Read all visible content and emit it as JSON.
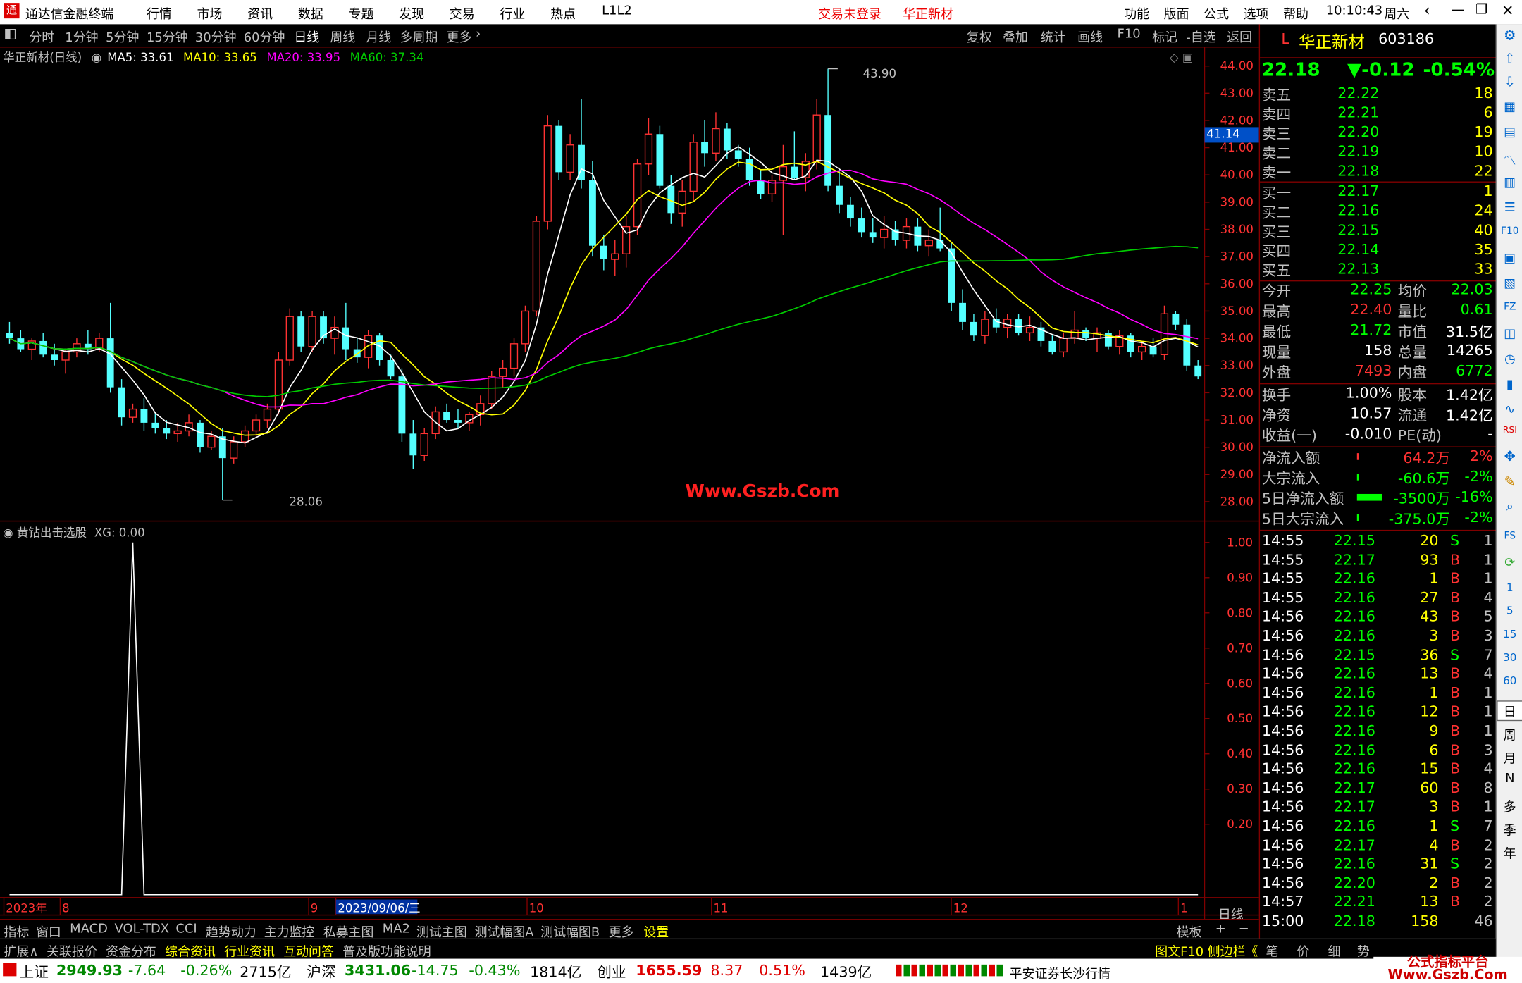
{
  "app": {
    "title": "通达信金融终端",
    "menu": [
      "行情",
      "市场",
      "资讯",
      "数据",
      "专题",
      "发现",
      "交易",
      "行业",
      "热点",
      "L1L2"
    ],
    "login_status": "交易未登录",
    "stock_tab": "华正新材",
    "right_menu": [
      "功能",
      "版面",
      "公式",
      "选项",
      "帮助"
    ],
    "time": "10:10:43",
    "weekday": "周六"
  },
  "periods": [
    "分时",
    "1分钟",
    "5分钟",
    "15分钟",
    "30分钟",
    "60分钟",
    "日线",
    "周线",
    "月线",
    "多周期",
    "更多"
  ],
  "active_period": "日线",
  "chart_tools": [
    "复权",
    "叠加",
    "统计",
    "画线",
    "F10",
    "标记",
    "-自选",
    "返回"
  ],
  "main_chart": {
    "title": "华正新材(日线)",
    "ma5": "MA5: 33.61",
    "ma10": "MA10: 33.65",
    "ma20": "MA20: 33.95",
    "ma60": "MA60: 37.34",
    "high_label": "43.90",
    "low_label": "28.06",
    "cursor_price": "41.14",
    "watermark": "Www.Gszb.Com",
    "y_ticks": [
      "44.00",
      "43.00",
      "42.00",
      "41.00",
      "40.00",
      "39.00",
      "38.00",
      "37.00",
      "36.00",
      "35.00",
      "34.00",
      "33.00",
      "32.00",
      "31.00",
      "30.00",
      "29.00",
      "28.00"
    ]
  },
  "indicator": {
    "title": "黄钻出击选股",
    "value": "XG: 0.00",
    "y_ticks": [
      "1.00",
      "0.90",
      "0.80",
      "0.70",
      "0.60",
      "0.50",
      "0.40",
      "0.30",
      "0.20"
    ]
  },
  "x_axis": {
    "labels": [
      "2023年",
      "8",
      "9",
      "2023/09/06/三",
      "10",
      "11",
      "12",
      "1"
    ],
    "period": "日线"
  },
  "chart_data": {
    "type": "candlestick",
    "ohlc_approx": [
      [
        34.2,
        34.6,
        33.8,
        34.0
      ],
      [
        34.0,
        34.3,
        33.5,
        33.6
      ],
      [
        33.6,
        34.0,
        33.2,
        33.9
      ],
      [
        33.9,
        34.2,
        33.3,
        33.4
      ],
      [
        33.4,
        33.8,
        33.0,
        33.2
      ],
      [
        33.2,
        33.6,
        32.7,
        33.5
      ],
      [
        33.5,
        34.0,
        33.3,
        33.8
      ],
      [
        33.8,
        34.3,
        33.4,
        33.6
      ],
      [
        33.6,
        34.2,
        33.5,
        34.0
      ],
      [
        34.0,
        35.3,
        32.0,
        32.2
      ],
      [
        32.2,
        32.5,
        30.8,
        31.1
      ],
      [
        31.1,
        31.6,
        30.9,
        31.4
      ],
      [
        31.4,
        31.8,
        30.6,
        30.9
      ],
      [
        30.9,
        31.3,
        30.5,
        30.7
      ],
      [
        30.7,
        31.0,
        30.3,
        30.5
      ],
      [
        30.5,
        30.9,
        30.2,
        30.6
      ],
      [
        30.6,
        31.2,
        30.4,
        30.9
      ],
      [
        30.9,
        31.0,
        29.8,
        30.0
      ],
      [
        30.0,
        30.6,
        29.9,
        30.4
      ],
      [
        30.4,
        30.7,
        28.06,
        29.6
      ],
      [
        29.6,
        30.4,
        29.4,
        30.2
      ],
      [
        30.2,
        30.8,
        30.0,
        30.6
      ],
      [
        30.6,
        31.2,
        30.4,
        31.0
      ],
      [
        31.0,
        31.6,
        30.7,
        31.4
      ],
      [
        31.4,
        33.5,
        31.2,
        33.2
      ],
      [
        33.2,
        35.1,
        33.0,
        34.8
      ],
      [
        34.8,
        35.0,
        33.5,
        33.7
      ],
      [
        33.7,
        35.0,
        33.5,
        34.8
      ],
      [
        34.8,
        35.0,
        33.8,
        34.0
      ],
      [
        34.0,
        34.8,
        33.4,
        34.4
      ],
      [
        34.4,
        35.3,
        33.2,
        33.6
      ],
      [
        33.6,
        34.0,
        33.1,
        33.3
      ],
      [
        33.3,
        34.3,
        32.9,
        34.1
      ],
      [
        34.1,
        34.2,
        33.0,
        33.2
      ],
      [
        33.2,
        33.4,
        32.5,
        32.6
      ],
      [
        32.6,
        32.9,
        30.2,
        30.5
      ],
      [
        30.5,
        31.0,
        29.2,
        29.7
      ],
      [
        29.7,
        30.7,
        29.5,
        30.5
      ],
      [
        30.5,
        31.5,
        30.3,
        31.3
      ],
      [
        31.3,
        31.6,
        30.9,
        31.0
      ],
      [
        31.0,
        31.4,
        30.7,
        30.9
      ],
      [
        30.9,
        31.3,
        30.6,
        31.2
      ],
      [
        31.2,
        31.9,
        30.8,
        31.6
      ],
      [
        31.6,
        32.8,
        31.4,
        32.6
      ],
      [
        32.6,
        33.2,
        32.2,
        32.9
      ],
      [
        32.9,
        34.0,
        32.6,
        33.8
      ],
      [
        33.8,
        35.2,
        33.5,
        35.0
      ],
      [
        35.0,
        38.5,
        34.8,
        38.3
      ],
      [
        38.3,
        42.2,
        38.0,
        41.8
      ],
      [
        41.8,
        42.0,
        39.8,
        40.1
      ],
      [
        40.1,
        41.5,
        39.8,
        41.1
      ],
      [
        41.1,
        42.8,
        39.5,
        39.8
      ],
      [
        39.8,
        40.5,
        37.0,
        37.4
      ],
      [
        37.4,
        37.8,
        36.5,
        36.9
      ],
      [
        36.9,
        37.6,
        36.3,
        37.1
      ],
      [
        37.1,
        38.5,
        36.6,
        38.1
      ],
      [
        38.1,
        40.6,
        37.8,
        40.4
      ],
      [
        40.4,
        42.1,
        40.0,
        41.5
      ],
      [
        41.5,
        41.8,
        39.5,
        39.6
      ],
      [
        39.6,
        40.0,
        38.2,
        38.6
      ],
      [
        38.6,
        39.8,
        38.1,
        39.4
      ],
      [
        39.4,
        41.5,
        39.0,
        41.2
      ],
      [
        41.2,
        42.0,
        40.3,
        40.8
      ],
      [
        40.8,
        42.3,
        40.5,
        41.7
      ],
      [
        41.7,
        41.9,
        40.6,
        40.9
      ],
      [
        40.9,
        41.1,
        40.3,
        40.6
      ],
      [
        40.6,
        41.0,
        39.6,
        39.8
      ],
      [
        39.8,
        40.2,
        39.1,
        39.3
      ],
      [
        39.3,
        40.0,
        39.0,
        39.8
      ],
      [
        39.8,
        41.1,
        37.8,
        40.3
      ],
      [
        40.3,
        41.6,
        39.8,
        39.9
      ],
      [
        39.9,
        40.8,
        39.4,
        40.5
      ],
      [
        40.5,
        42.8,
        40.2,
        42.2
      ],
      [
        42.2,
        43.9,
        39.4,
        39.6
      ],
      [
        39.6,
        40.2,
        38.6,
        38.9
      ],
      [
        38.9,
        39.2,
        38.1,
        38.4
      ],
      [
        38.4,
        38.8,
        37.7,
        37.9
      ],
      [
        37.9,
        38.4,
        37.5,
        37.7
      ],
      [
        37.7,
        38.5,
        37.3,
        38.0
      ],
      [
        38.0,
        38.3,
        37.4,
        37.6
      ],
      [
        37.6,
        38.4,
        37.3,
        38.1
      ],
      [
        38.1,
        38.4,
        37.2,
        37.4
      ],
      [
        37.4,
        38.0,
        37.0,
        37.6
      ],
      [
        37.6,
        38.8,
        37.2,
        37.3
      ],
      [
        37.3,
        37.5,
        35.0,
        35.3
      ],
      [
        35.3,
        35.8,
        34.3,
        34.6
      ],
      [
        34.6,
        34.9,
        33.9,
        34.1
      ],
      [
        34.1,
        35.0,
        33.8,
        34.7
      ],
      [
        34.7,
        35.1,
        34.2,
        34.4
      ],
      [
        34.4,
        34.9,
        34.0,
        34.7
      ],
      [
        34.7,
        34.9,
        34.1,
        34.2
      ],
      [
        34.2,
        34.8,
        33.9,
        34.4
      ],
      [
        34.4,
        34.6,
        33.7,
        33.9
      ],
      [
        33.9,
        34.1,
        33.4,
        33.5
      ],
      [
        33.5,
        34.2,
        33.3,
        34.0
      ],
      [
        34.0,
        35.0,
        33.8,
        34.3
      ],
      [
        34.3,
        34.4,
        33.9,
        34.0
      ],
      [
        34.0,
        34.4,
        33.5,
        34.2
      ],
      [
        34.2,
        34.3,
        33.6,
        33.7
      ],
      [
        33.7,
        34.3,
        33.4,
        34.1
      ],
      [
        34.1,
        34.2,
        33.3,
        33.5
      ],
      [
        33.5,
        33.9,
        33.2,
        33.7
      ],
      [
        33.7,
        34.0,
        33.3,
        33.4
      ],
      [
        33.4,
        35.2,
        33.2,
        34.9
      ],
      [
        34.9,
        35.0,
        34.3,
        34.5
      ],
      [
        34.5,
        34.7,
        32.8,
        33.0
      ],
      [
        33.0,
        33.2,
        32.5,
        32.6
      ]
    ],
    "indicator_spike_index": 11,
    "price_range": [
      28.0,
      44.0
    ],
    "indicator_range": [
      0.0,
      1.0
    ]
  },
  "quote": {
    "name": "华正新材",
    "code": "603186",
    "price": "22.18",
    "change": "▼-0.12",
    "pct": "-0.54%",
    "asks": [
      [
        "卖五",
        "22.22",
        "18"
      ],
      [
        "卖四",
        "22.21",
        "6"
      ],
      [
        "卖三",
        "22.20",
        "19"
      ],
      [
        "卖二",
        "22.19",
        "10"
      ],
      [
        "卖一",
        "22.18",
        "22"
      ]
    ],
    "bids": [
      [
        "买一",
        "22.17",
        "1"
      ],
      [
        "买二",
        "22.16",
        "24"
      ],
      [
        "买三",
        "22.15",
        "40"
      ],
      [
        "买四",
        "22.14",
        "35"
      ],
      [
        "买五",
        "22.13",
        "33"
      ]
    ],
    "stats": [
      [
        "今开",
        "22.25",
        "均价",
        "22.03"
      ],
      [
        "最高",
        "22.40",
        "量比",
        "0.61"
      ],
      [
        "最低",
        "21.72",
        "市值",
        "31.5亿"
      ],
      [
        "现量",
        "158",
        "总量",
        "14265"
      ],
      [
        "外盘",
        "7493",
        "内盘",
        "6772"
      ]
    ],
    "stats2": [
      [
        "换手",
        "1.00%",
        "股本",
        "1.42亿"
      ],
      [
        "净资",
        "10.57",
        "流通",
        "1.42亿"
      ],
      [
        "收益(一)",
        "-0.010",
        "PE(动)",
        "-"
      ]
    ],
    "flows": [
      [
        "净流入额",
        "64.2万",
        "2%"
      ],
      [
        "大宗流入",
        "-60.6万",
        "-2%"
      ],
      [
        "5日净流入额",
        "-3500万",
        "-16%"
      ],
      [
        "5日大宗流入",
        "-375.0万",
        "-2%"
      ]
    ],
    "ticks": [
      [
        "14:55",
        "22.15",
        "20",
        "S",
        "1"
      ],
      [
        "14:55",
        "22.17",
        "93",
        "B",
        "1"
      ],
      [
        "14:55",
        "22.16",
        "1",
        "B",
        "1"
      ],
      [
        "14:55",
        "22.16",
        "27",
        "B",
        "4"
      ],
      [
        "14:56",
        "22.16",
        "43",
        "B",
        "5"
      ],
      [
        "14:56",
        "22.16",
        "3",
        "B",
        "3"
      ],
      [
        "14:56",
        "22.15",
        "36",
        "S",
        "7"
      ],
      [
        "14:56",
        "22.16",
        "13",
        "B",
        "4"
      ],
      [
        "14:56",
        "22.16",
        "1",
        "B",
        "1"
      ],
      [
        "14:56",
        "22.16",
        "12",
        "B",
        "1"
      ],
      [
        "14:56",
        "22.16",
        "9",
        "B",
        "1"
      ],
      [
        "14:56",
        "22.16",
        "6",
        "B",
        "3"
      ],
      [
        "14:56",
        "22.16",
        "15",
        "B",
        "4"
      ],
      [
        "14:56",
        "22.17",
        "60",
        "B",
        "8"
      ],
      [
        "14:56",
        "22.17",
        "3",
        "B",
        "1"
      ],
      [
        "14:56",
        "22.16",
        "1",
        "S",
        "7"
      ],
      [
        "14:56",
        "22.17",
        "4",
        "B",
        "2"
      ],
      [
        "14:56",
        "22.16",
        "31",
        "S",
        "2"
      ],
      [
        "14:56",
        "22.20",
        "2",
        "B",
        "2"
      ],
      [
        "14:57",
        "22.21",
        "13",
        "B",
        "2"
      ],
      [
        "15:00",
        "22.18",
        "158",
        "",
        "46"
      ]
    ]
  },
  "icon_strip": [
    "5",
    "15",
    "30",
    "60",
    "日",
    "周",
    "月",
    "N",
    "多",
    "季",
    "年"
  ],
  "bottom_tabs": [
    "指标",
    "窗口",
    "MACD",
    "VOL-TDX",
    "CCI",
    "趋势动力",
    "主力监控",
    "私募主图",
    "MA2",
    "测试主图",
    "测试幅图A",
    "测试幅图B",
    "更多",
    "设置"
  ],
  "bottom_right": [
    "模板",
    "+",
    "−"
  ],
  "bottom_tabs2": [
    "扩展∧",
    "关联报价",
    "资金分布",
    "综合资讯",
    "行业资讯",
    "互动问答",
    "普及版功能说明"
  ],
  "bottom_tabs2_right": [
    "图文F10",
    "侧边栏《",
    "笔",
    "价",
    "细",
    "势"
  ],
  "status": {
    "sh_name": "上证",
    "sh_val": "2949.93",
    "sh_chg": "-7.64",
    "sh_pct": "-0.26%",
    "sh_amt": "2715亿",
    "hs_name": "沪深",
    "hs_val": "3431.06",
    "hs_chg": "-14.75",
    "hs_pct": "-0.43%",
    "hs_amt": "1814亿",
    "cy_name": "创业",
    "cy_val": "1655.59",
    "cy_chg": "8.37",
    "cy_pct": "0.51%",
    "cy_amt": "1439亿",
    "broker": "平安证券长沙行情",
    "logo": "公式指标平台 Www.Gszb.Com"
  },
  "colors": {
    "up": "#ff3232",
    "down": "#54ffff",
    "ma5": "#ffffff",
    "ma10": "#ffff00",
    "ma20": "#ff00ff",
    "ma60": "#00cc00",
    "grid": "#800000"
  }
}
